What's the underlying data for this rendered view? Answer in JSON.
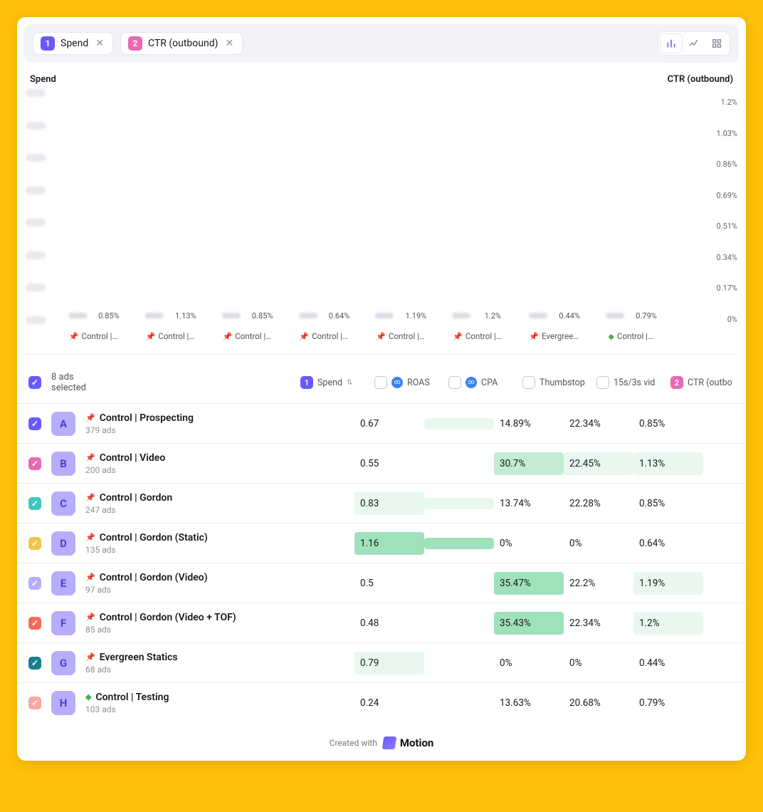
{
  "toolbar": {
    "chips": [
      {
        "badge": "1",
        "badgeClass": "badge-purple",
        "label": "Spend"
      },
      {
        "badge": "2",
        "badgeClass": "badge-pink",
        "label": "CTR (outbound)"
      }
    ]
  },
  "chart_data": {
    "type": "bar",
    "left_axis_label": "Spend",
    "right_axis_label": "CTR (outbound)",
    "right_axis_ticks": [
      "1.2%",
      "1.03%",
      "0.86%",
      "0.69%",
      "0.51%",
      "0.34%",
      "0.17%",
      "0%"
    ],
    "left_axis_blurred_ticks": 8,
    "ctr_max": 1.2,
    "categories": [
      "Control |…",
      "Control |…",
      "Control |…",
      "Control |…",
      "Control |…",
      "Control |…",
      "Evergree…",
      "Control |…"
    ],
    "category_icons": [
      "pin",
      "pin",
      "pin",
      "pin",
      "pin",
      "pin",
      "pin",
      "pin-green"
    ],
    "series": [
      {
        "name": "Spend",
        "color": "#6a5af9",
        "relative_heights": [
          0.98,
          0.58,
          0.55,
          0.27,
          0.26,
          0.26,
          0.18,
          0.15
        ],
        "value_labels": [
          "",
          "",
          "",
          "",
          "",
          "",
          "",
          ""
        ],
        "labels_blurred": true
      },
      {
        "name": "CTR (outbound)",
        "color": "#e869b4",
        "values_pct": [
          0.85,
          1.13,
          0.85,
          0.64,
          1.19,
          1.2,
          0.44,
          0.79
        ],
        "value_labels": [
          "0.85%",
          "1.13%",
          "0.85%",
          "0.64%",
          "1.19%",
          "1.2%",
          "0.44%",
          "0.79%"
        ]
      }
    ]
  },
  "table": {
    "selected_text": "8 ads selected",
    "columns": [
      {
        "key": "spend",
        "label": "Spend",
        "badge": "1",
        "badgeClass": "badge-purple",
        "sort": true
      },
      {
        "key": "roas",
        "label": "ROAS",
        "checkbox": true,
        "icon": "roas"
      },
      {
        "key": "cpa",
        "label": "CPA",
        "checkbox": true,
        "icon": "roas"
      },
      {
        "key": "thumb",
        "label": "Thumbstop",
        "checkbox": true
      },
      {
        "key": "vids",
        "label": "15s/3s vid",
        "checkbox": true
      },
      {
        "key": "ctr",
        "label": "CTR (outbo",
        "badge": "2",
        "badgeClass": "badge-pink"
      }
    ],
    "rows": [
      {
        "chk": "#6a5af9",
        "letter": "A",
        "pin": "pin",
        "name": "Control | Prospecting",
        "sub": "379 ads",
        "spend": "blur",
        "roas": "0.67",
        "roas_hl": "",
        "cpa": "blur-hl",
        "thumb": "14.89%",
        "thumb_hl": "",
        "vids": "22.34%",
        "vids_hl": "",
        "ctr": "0.85%",
        "ctr_hl": ""
      },
      {
        "chk": "#e869b4",
        "letter": "B",
        "pin": "pin",
        "name": "Control | Video",
        "sub": "200 ads",
        "spend": "blur",
        "roas": "0.55",
        "roas_hl": "",
        "cpa": "blur",
        "thumb": "30.7%",
        "thumb_hl": "hl2",
        "vids": "22.45%",
        "vids_hl": "hl1",
        "ctr": "1.13%",
        "ctr_hl": "hl1"
      },
      {
        "chk": "#3fc7c0",
        "letter": "C",
        "pin": "pin",
        "name": "Control | Gordon",
        "sub": "247 ads",
        "spend": "blur",
        "roas": "0.83",
        "roas_hl": "hl1",
        "cpa": "blur-hl",
        "thumb": "13.74%",
        "thumb_hl": "",
        "vids": "22.28%",
        "vids_hl": "",
        "ctr": "0.85%",
        "ctr_hl": ""
      },
      {
        "chk": "#f6c34a",
        "letter": "D",
        "pin": "pin",
        "name": "Control | Gordon (Static)",
        "sub": "135 ads",
        "spend": "blur",
        "roas": "1.16",
        "roas_hl": "hl3",
        "cpa": "blur-hl3",
        "thumb": "0%",
        "thumb_hl": "",
        "vids": "0%",
        "vids_hl": "",
        "ctr": "0.64%",
        "ctr_hl": ""
      },
      {
        "chk": "#b6aefb",
        "letter": "E",
        "pin": "pin",
        "name": "Control | Gordon (Video)",
        "sub": "97 ads",
        "spend": "blur",
        "roas": "0.5",
        "roas_hl": "",
        "cpa": "blur",
        "thumb": "35.47%",
        "thumb_hl": "hl3",
        "vids": "22.2%",
        "vids_hl": "",
        "ctr": "1.19%",
        "ctr_hl": "hl1"
      },
      {
        "chk": "#f36b5b",
        "letter": "F",
        "pin": "pin",
        "name": "Control | Gordon (Video + TOF)",
        "sub": "85 ads",
        "spend": "blur",
        "roas": "0.48",
        "roas_hl": "",
        "cpa": "blur",
        "thumb": "35.43%",
        "thumb_hl": "hl3",
        "vids": "22.34%",
        "vids_hl": "",
        "ctr": "1.2%",
        "ctr_hl": "hl1"
      },
      {
        "chk": "#1b7f8c",
        "letter": "G",
        "pin": "pin",
        "name": "Evergreen Statics",
        "sub": "68 ads",
        "spend": "blur",
        "roas": "0.79",
        "roas_hl": "hl1",
        "cpa": "blur",
        "thumb": "0%",
        "thumb_hl": "",
        "vids": "0%",
        "vids_hl": "",
        "ctr": "0.44%",
        "ctr_hl": ""
      },
      {
        "chk": "#f7a8a0",
        "letter": "H",
        "pin": "pin-green",
        "name": "Control | Testing",
        "sub": "103 ads",
        "spend": "blur",
        "roas": "0.24",
        "roas_hl": "",
        "cpa": "blur",
        "thumb": "13.63%",
        "thumb_hl": "",
        "vids": "20.68%",
        "vids_hl": "",
        "ctr": "0.79%",
        "ctr_hl": ""
      }
    ]
  },
  "footer": {
    "created_with": "Created with",
    "brand": "Motion"
  }
}
